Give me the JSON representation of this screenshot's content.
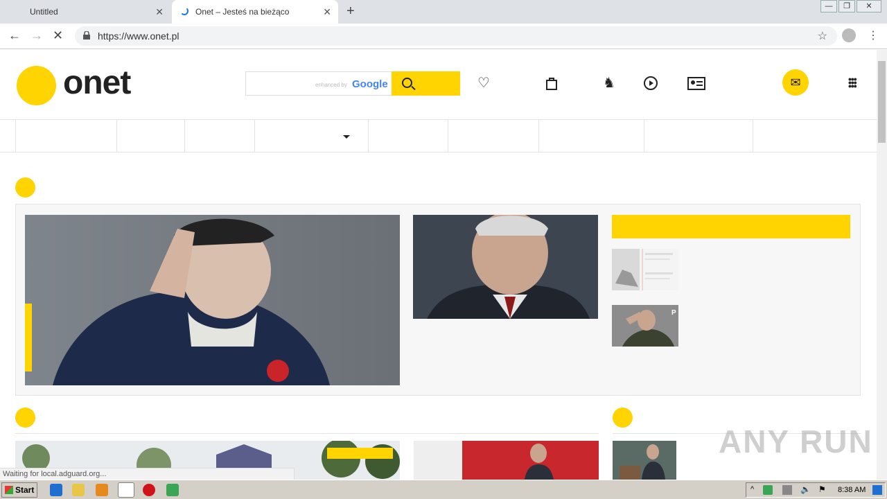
{
  "browser": {
    "tabs": [
      {
        "title": "Untitled",
        "close": "✕"
      },
      {
        "title": "Onet – Jesteś na bieżąco",
        "close": "✕"
      }
    ],
    "new_tab": "+",
    "url": "https://www.onet.pl",
    "status_text": "Waiting for local.adguard.org..."
  },
  "header": {
    "logo_text": "onet",
    "search_enhanced": "enhanced by",
    "search_google": "Google"
  },
  "taskbar": {
    "start_label": "Start",
    "clock": "8:38 AM"
  },
  "watermark": "ANY RUN",
  "colors": {
    "accent": "#ffd400",
    "panel_bg": "#f7f7f7"
  }
}
